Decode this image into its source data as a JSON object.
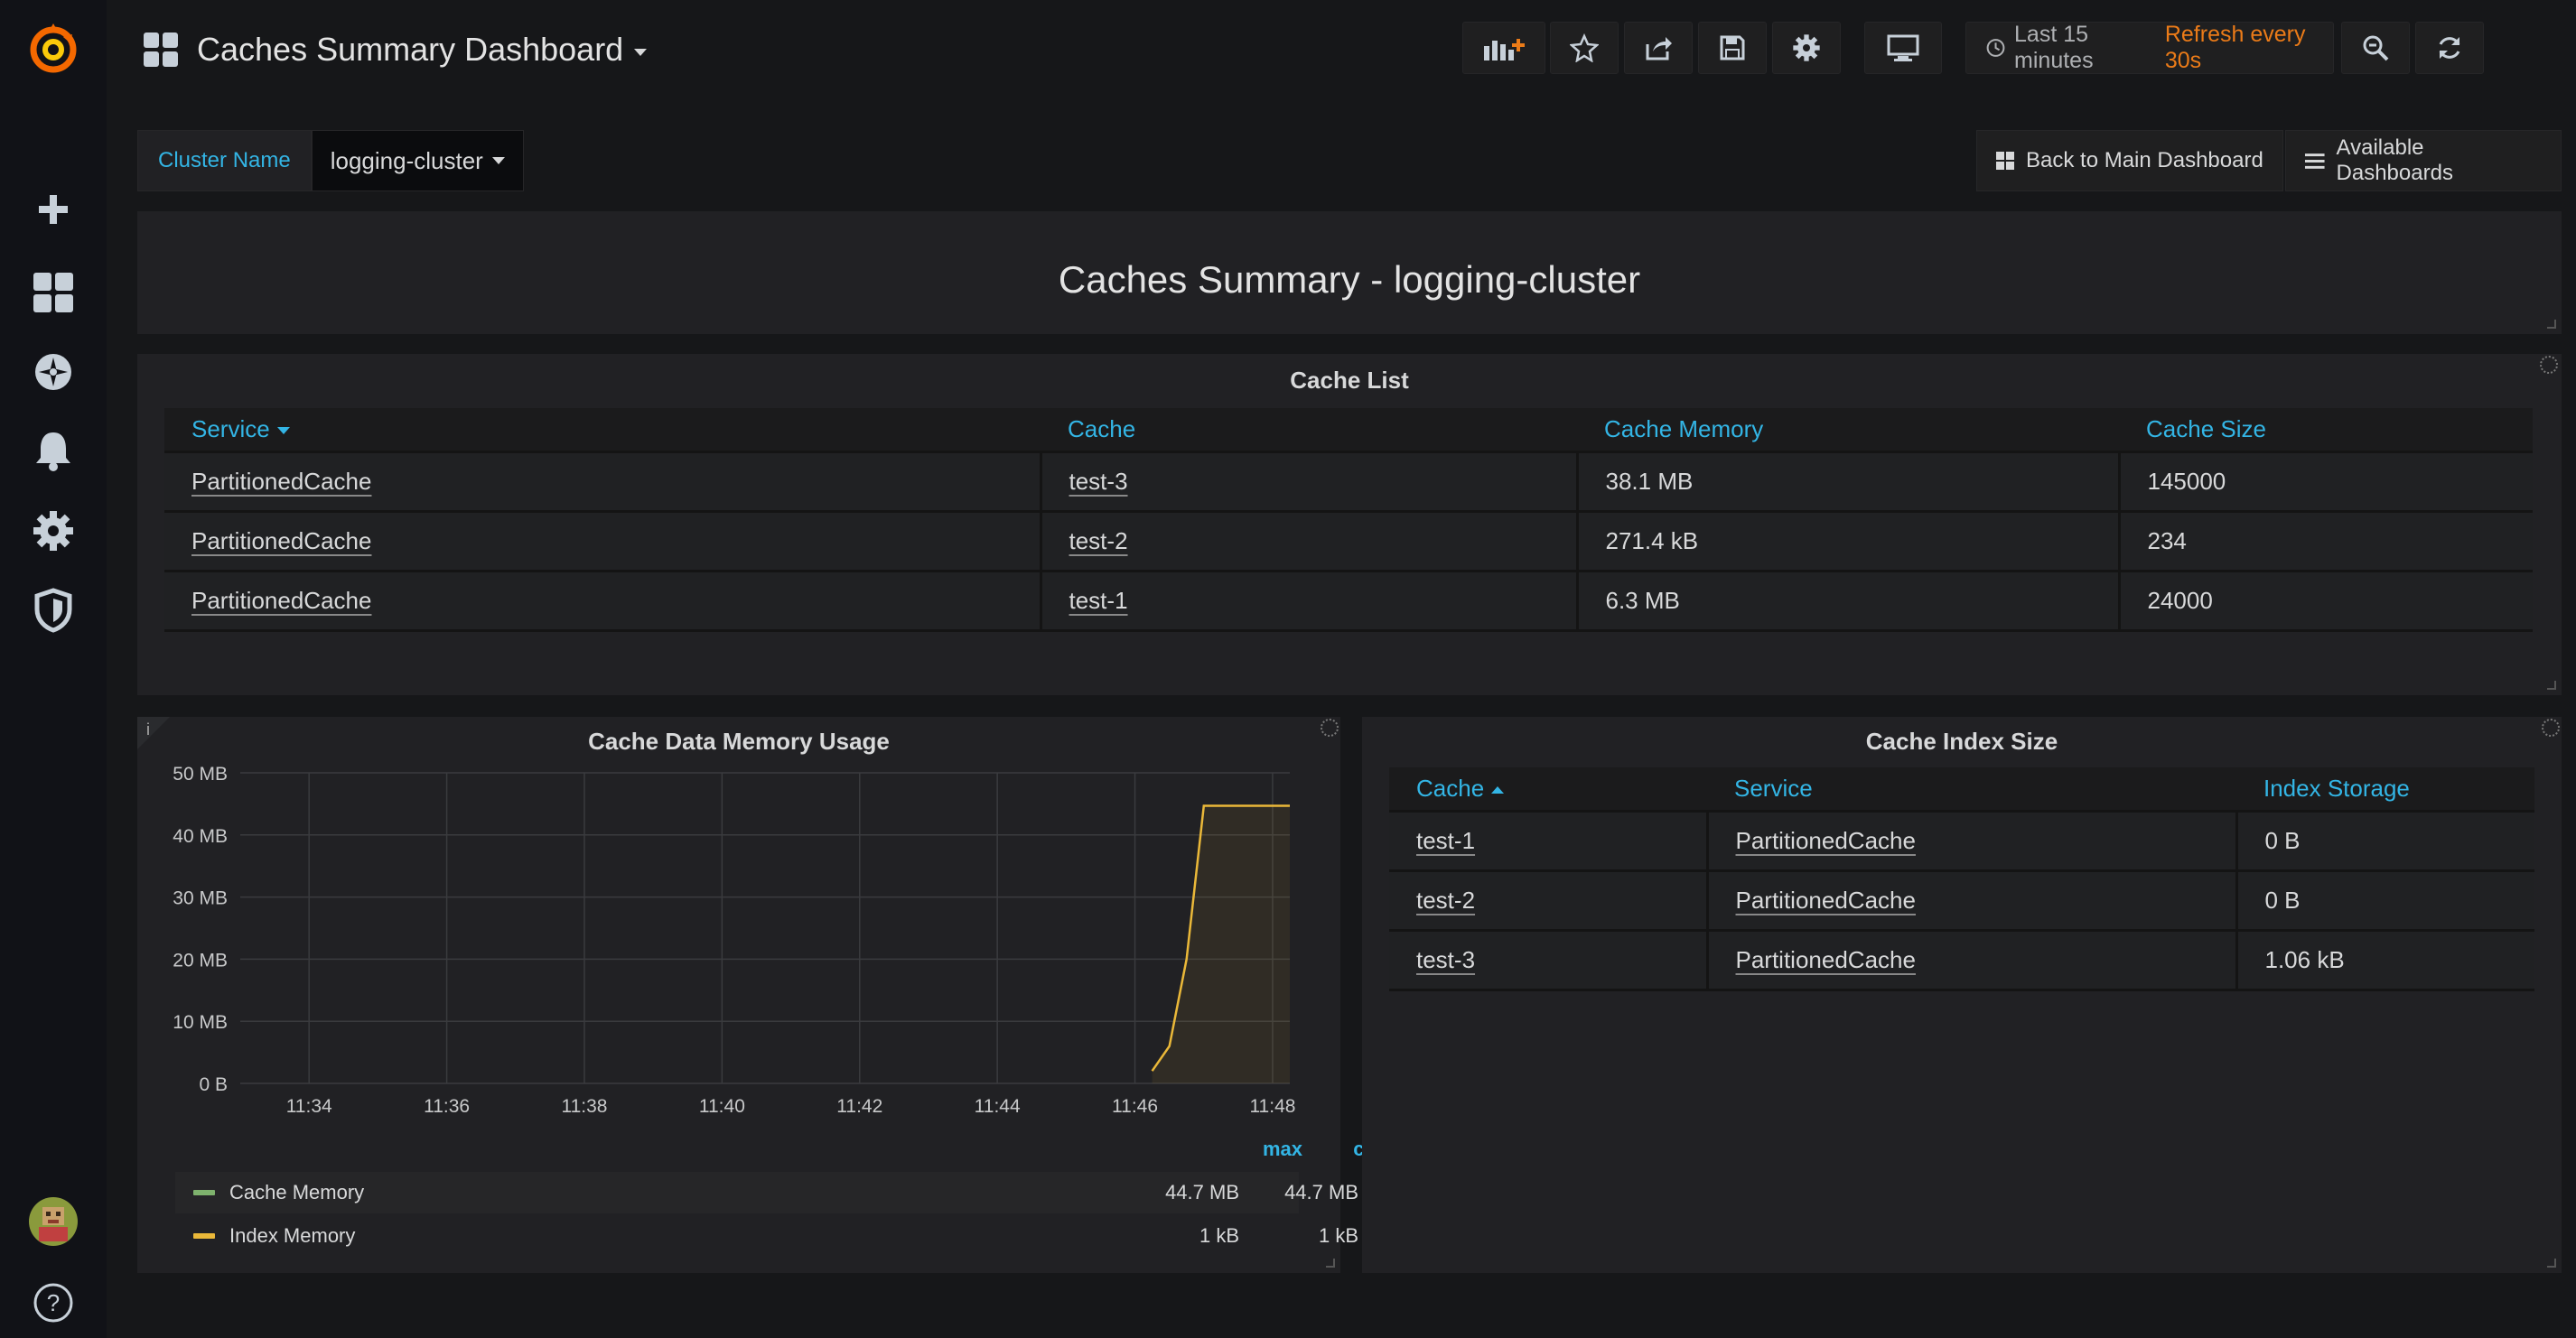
{
  "colors": {
    "accent": "#33b5e5",
    "refresh": "#eb7b18",
    "cache_memory_series": "#7eb26d",
    "index_memory_series": "#eab839"
  },
  "sidebar": {
    "logo": "grafana-logo-icon",
    "items": [
      {
        "name": "plus-icon"
      },
      {
        "name": "dashboards-icon"
      },
      {
        "name": "explore-compass-icon"
      },
      {
        "name": "alerting-bell-icon"
      },
      {
        "name": "configuration-gear-icon"
      },
      {
        "name": "server-admin-shield-icon"
      }
    ],
    "bottom": [
      {
        "name": "user-avatar"
      },
      {
        "name": "help-icon"
      }
    ]
  },
  "header": {
    "title": "Caches Summary Dashboard",
    "time_range": "Last 15 minutes",
    "refresh": "Refresh every 30s"
  },
  "variables": {
    "cluster_label": "Cluster Name",
    "cluster_value": "logging-cluster"
  },
  "links": {
    "back": "Back to Main Dashboard",
    "available": "Available Dashboards"
  },
  "text_panel": {
    "title": "Caches Summary - logging-cluster"
  },
  "cache_list": {
    "title": "Cache List",
    "columns": [
      "Service",
      "Cache",
      "Cache Memory",
      "Cache Size"
    ],
    "rows": [
      [
        "PartitionedCache",
        "test-3",
        "38.1 MB",
        "145000"
      ],
      [
        "PartitionedCache",
        "test-2",
        "271.4 kB",
        "234"
      ],
      [
        "PartitionedCache",
        "test-1",
        "6.3 MB",
        "24000"
      ]
    ]
  },
  "index_size": {
    "title": "Cache Index Size",
    "columns": [
      "Cache",
      "Service",
      "Index Storage"
    ],
    "rows": [
      [
        "test-1",
        "PartitionedCache",
        "0 B"
      ],
      [
        "test-2",
        "PartitionedCache",
        "0 B"
      ],
      [
        "test-3",
        "PartitionedCache",
        "1.06 kB"
      ]
    ]
  },
  "memory_panel": {
    "info": "i",
    "legend_headers": [
      "max",
      "current"
    ],
    "legend": [
      {
        "name": "Cache Memory",
        "max": "44.7 MB",
        "current": "44.7 MB"
      },
      {
        "name": "Index Memory",
        "max": "1 kB",
        "current": "1 kB"
      }
    ]
  },
  "chart_data": {
    "type": "line",
    "title": "Cache Data Memory Usage",
    "xlabel": "",
    "ylabel": "",
    "x_ticks": [
      "11:34",
      "11:36",
      "11:38",
      "11:40",
      "11:42",
      "11:44",
      "11:46",
      "11:48"
    ],
    "y_ticks": [
      "0 B",
      "10 MB",
      "20 MB",
      "30 MB",
      "40 MB",
      "50 MB"
    ],
    "xlim": [
      "11:33:00",
      "11:48:15"
    ],
    "ylim": [
      0,
      50
    ],
    "grid": true,
    "series": [
      {
        "name": "Cache Memory",
        "x": [],
        "y": []
      },
      {
        "name": "Index Memory",
        "x": [
          "11:46:15",
          "11:46:30",
          "11:46:45",
          "11:47:00",
          "11:47:15",
          "11:47:30",
          "11:48:00",
          "11:48:15"
        ],
        "y": [
          2,
          6,
          20,
          44.7,
          44.7,
          44.7,
          44.7,
          44.7
        ]
      }
    ]
  }
}
